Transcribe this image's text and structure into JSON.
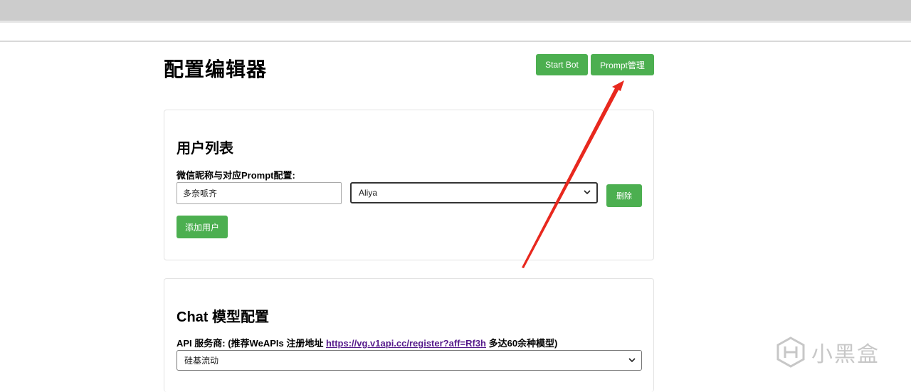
{
  "page": {
    "title": "配置编辑器",
    "actions": {
      "start_bot_label": "Start Bot",
      "prompt_manage_label": "Prompt管理"
    }
  },
  "users_section": {
    "title": "用户列表",
    "field_label": "微信昵称与对应Prompt配置:",
    "nickname_value": "多奈哌齐",
    "prompt_selected": "Aliya",
    "delete_label": "删除",
    "add_user_label": "添加用户"
  },
  "chat_section": {
    "title": "Chat 模型配置",
    "provider_label_prefix": "API 服务商: (推荐WeAPIs 注册地址 ",
    "provider_link": "https://vg.v1api.cc/register?aff=Rf3h",
    "provider_label_suffix": " 多达60余种模型)",
    "provider_selected": "硅基流动"
  },
  "watermark": {
    "text": "小黑盒",
    "icon": "xiaoheihe-logo-icon"
  },
  "colors": {
    "button_green": "#4caf50",
    "annotation_red": "#e8281e",
    "link_purple": "#551a8b"
  }
}
